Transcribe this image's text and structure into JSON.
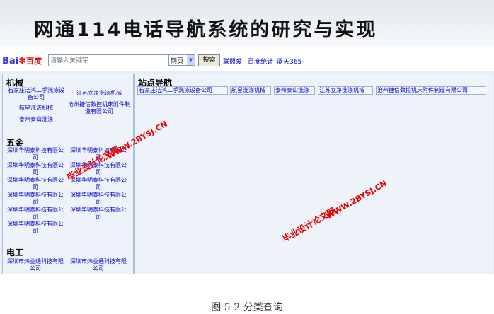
{
  "banner": {
    "title": "网通114电话导航系统的研究与实现"
  },
  "search": {
    "logo_text": "Bai",
    "logo_paw": "✽",
    "logo_cn": "百度",
    "placeholder": "请输入关键字",
    "scope": "网页",
    "button": "搜索",
    "links": [
      "联盟爱",
      "百度统计",
      "蓝天365"
    ]
  },
  "categories": {
    "machinery": {
      "title": "机械",
      "items": [
        "石家庄洁鸿二手洗涤设备公司",
        "江苏立净洗涤机械",
        "航星洗涤机械",
        "沧州捷信数控机床附件制造有限公司",
        "泰州泰山洗涤"
      ]
    },
    "hardware": {
      "title": "五金",
      "items": [
        "深圳华明泰科技有限公司",
        "深圳华明泰科技有限公司",
        "深圳华明泰科技有限公司",
        "深圳华明泰科技有限公司",
        "深圳华明泰科技有限公司",
        "深圳华明泰科技有限公司",
        "深圳华明泰科技有限公司",
        "深圳华明泰科技有限公司",
        "深圳华明泰科技有限公司",
        "深圳华明泰科技有限公司",
        "深圳华明泰科技有限公司"
      ]
    },
    "electrical": {
      "title": "电工",
      "items": [
        "深圳市炜业通科技有限公司",
        "深圳市炜业通科技有限公司"
      ]
    }
  },
  "site_nav": {
    "title": "站点导航",
    "items": [
      "石家庄洁鸿二手洗涤设备公司",
      "航星洗涤机械",
      "泰州泰山洗涤",
      "江苏立净洗涤机械",
      "沧州捷信数控机床附件制造有限公司"
    ]
  },
  "watermarks": [
    "毕业设计论文网",
    "WWW.2BYSJ.CN",
    "毕业设计论文网",
    "WWW.2BYSJ.CN"
  ],
  "caption": "图 5-2 分类查询"
}
